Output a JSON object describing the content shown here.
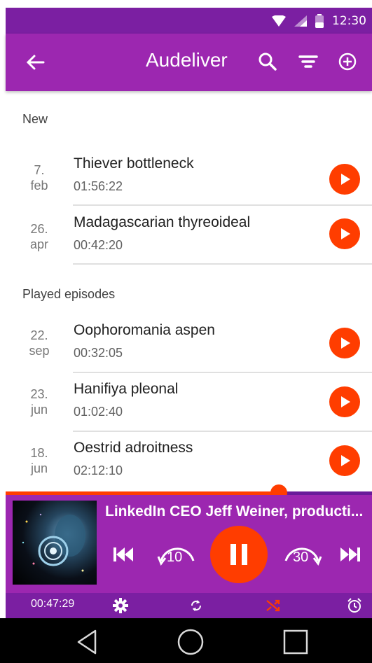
{
  "status_bar": {
    "time": "12:30"
  },
  "app_bar": {
    "title": "Audeliver"
  },
  "sections": [
    {
      "header": "New",
      "episodes": [
        {
          "date_day": "7.",
          "date_month": "feb",
          "title": "Thiever bottleneck",
          "duration": "01:56:22"
        },
        {
          "date_day": "26.",
          "date_month": "apr",
          "title": "Madagascarian thyreoideal",
          "duration": "00:42:20"
        }
      ]
    },
    {
      "header": "Played episodes",
      "episodes": [
        {
          "date_day": "22.",
          "date_month": "sep",
          "title": "Oophoromania aspen",
          "duration": "00:32:05"
        },
        {
          "date_day": "23.",
          "date_month": "jun",
          "title": "Hanifiya pleonal",
          "duration": "01:02:40"
        },
        {
          "date_day": "18.",
          "date_month": "jun",
          "title": "Oestrid adroitness",
          "duration": "02:12:10"
        }
      ]
    }
  ],
  "player": {
    "title": "LinkedIn CEO Jeff Weiner, producti...",
    "skip_back_label": "10",
    "skip_forward_label": "30",
    "elapsed": "00:47:29",
    "progress": 0.745,
    "shuffle_active": true
  },
  "colors": {
    "primary": "#9c27b0",
    "primary_dark": "#7b1fa2",
    "accent": "#ff3d00"
  }
}
